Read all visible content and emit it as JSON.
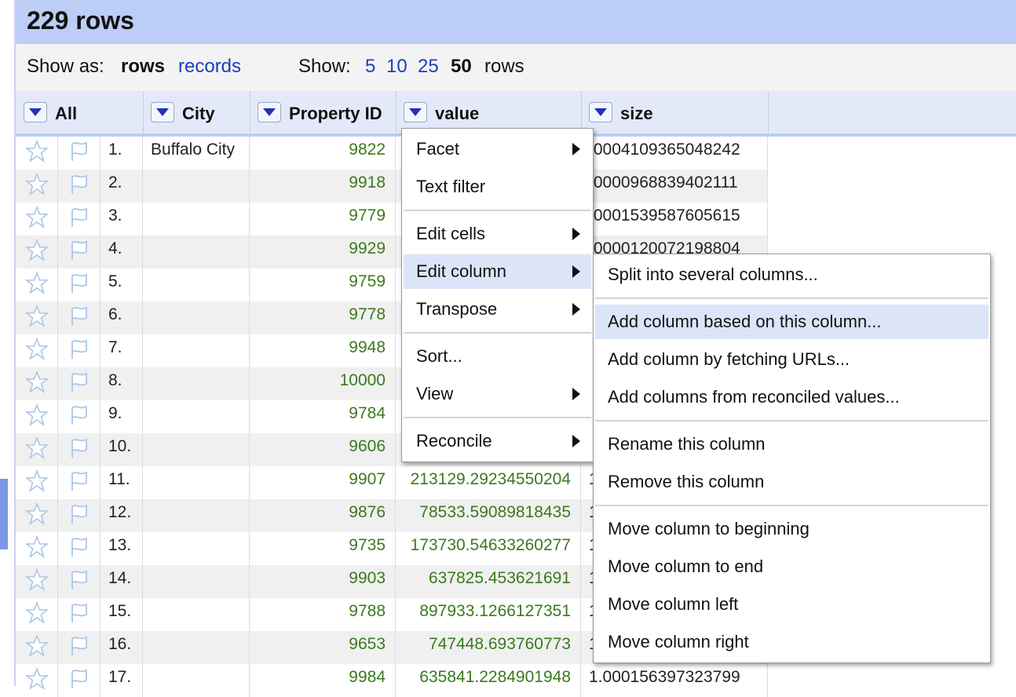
{
  "header": {
    "title": "229 rows"
  },
  "options": {
    "show_as_label": "Show as:",
    "rows_label": "rows",
    "records_label": "records",
    "show_label": "Show:",
    "page_sizes": [
      "5",
      "10",
      "25",
      "50"
    ],
    "rows_suffix": "rows"
  },
  "columns": [
    "All",
    "City",
    "Property ID",
    "value",
    "size"
  ],
  "rows": [
    {
      "num": "1.",
      "city": "Buffalo City",
      "pid": "9822",
      "value": "",
      "size": ".0004109365048242"
    },
    {
      "num": "2.",
      "city": "",
      "pid": "9918",
      "value": "",
      "size": ".0000968839402111"
    },
    {
      "num": "3.",
      "city": "",
      "pid": "9779",
      "value": "",
      "size": ".0001539587605615"
    },
    {
      "num": "4.",
      "city": "",
      "pid": "9929",
      "value": "",
      "size": ".0000120072198804"
    },
    {
      "num": "5.",
      "city": "",
      "pid": "9759",
      "value": "",
      "size": ""
    },
    {
      "num": "6.",
      "city": "",
      "pid": "9778",
      "value": "",
      "size": ""
    },
    {
      "num": "7.",
      "city": "",
      "pid": "9948",
      "value": "",
      "size": ""
    },
    {
      "num": "8.",
      "city": "",
      "pid": "10000",
      "value": "",
      "size": ""
    },
    {
      "num": "9.",
      "city": "",
      "pid": "9784",
      "value": "",
      "size": ""
    },
    {
      "num": "10.",
      "city": "",
      "pid": "9606",
      "value": "",
      "size": ""
    },
    {
      "num": "11.",
      "city": "",
      "pid": "9907",
      "value": "213129.29234550204",
      "size": "1"
    },
    {
      "num": "12.",
      "city": "",
      "pid": "9876",
      "value": "78533.59089818435",
      "size": "1"
    },
    {
      "num": "13.",
      "city": "",
      "pid": "9735",
      "value": "173730.54633260277",
      "size": "1"
    },
    {
      "num": "14.",
      "city": "",
      "pid": "9903",
      "value": "637825.453621691",
      "size": "1"
    },
    {
      "num": "15.",
      "city": "",
      "pid": "9788",
      "value": "897933.1266127351",
      "size": "1"
    },
    {
      "num": "16.",
      "city": "",
      "pid": "9653",
      "value": "747448.693760773",
      "size": "1"
    },
    {
      "num": "17.",
      "city": "",
      "pid": "9984",
      "value": "635841.2284901948",
      "size": "1.000156397323799"
    }
  ],
  "menu": {
    "facet": "Facet",
    "text_filter": "Text filter",
    "edit_cells": "Edit cells",
    "edit_column": "Edit column",
    "transpose": "Transpose",
    "sort": "Sort...",
    "view": "View",
    "reconcile": "Reconcile"
  },
  "submenu": {
    "split": "Split into several columns...",
    "add_based": "Add column based on this column...",
    "add_fetch": "Add column by fetching URLs...",
    "add_reconciled": "Add columns from reconciled values...",
    "rename": "Rename this column",
    "remove": "Remove this column",
    "move_begin": "Move column to beginning",
    "move_end": "Move column to end",
    "move_left": "Move column left",
    "move_right": "Move column right"
  },
  "colors": {
    "accent": "#bccdf6",
    "link": "#1a3fbf",
    "number": "#3a7a1c",
    "hover": "#dce5f8"
  }
}
